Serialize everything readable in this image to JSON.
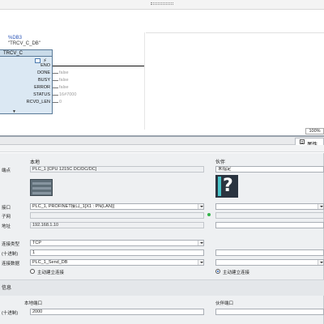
{
  "editor": {
    "db_tag": "%DB3",
    "db_name": "\"TRCV_C_DB\"",
    "block_title": "TRCV_C",
    "collapse_glyph": "▼",
    "pins": [
      {
        "name": "ENO",
        "value": ""
      },
      {
        "name": "DONE",
        "value": "false"
      },
      {
        "name": "BUSY",
        "value": "false"
      },
      {
        "name": "ERROR",
        "value": "false"
      },
      {
        "name": "STATUS",
        "value": "16#7000"
      },
      {
        "name": "RCVD_LEN",
        "value": "0"
      }
    ],
    "zoom": "100%"
  },
  "inspector": {
    "properties_tab": "属性",
    "local_header": "本地",
    "partner_header": "伙伴",
    "endpoint_label": "端点",
    "local_endpoint": "PLC_1 [CPU 1215C DC/DC/DC]",
    "partner_endpoint": "未指定",
    "interface_label": "接口",
    "local_interface": "PLC_1, PROFINET接口_1[X1 : PN(LAN)]",
    "subnet_label": "子网",
    "address_label": "地址",
    "local_address": "192.168.1.10",
    "conn_type_label": "连接类型",
    "conn_type": "TCP",
    "conn_id_label": "(十进制)",
    "conn_id": "1",
    "conn_data_label": "连接数据",
    "conn_data": "PLC_1_Send_DB",
    "local_active_label": "主动建立连接",
    "partner_active_label": "主动建立连接",
    "partner_active_checked": true,
    "local_active_checked": false,
    "info_section": "信息",
    "local_port_header": "本地端口",
    "partner_port_header": "伙伴端口",
    "port_label": "(十进制)",
    "local_port": "2000"
  },
  "colors": {
    "accent": "#2b55b8",
    "block_fill": "#dbe8f3",
    "ok_dot": "#34b34a"
  }
}
